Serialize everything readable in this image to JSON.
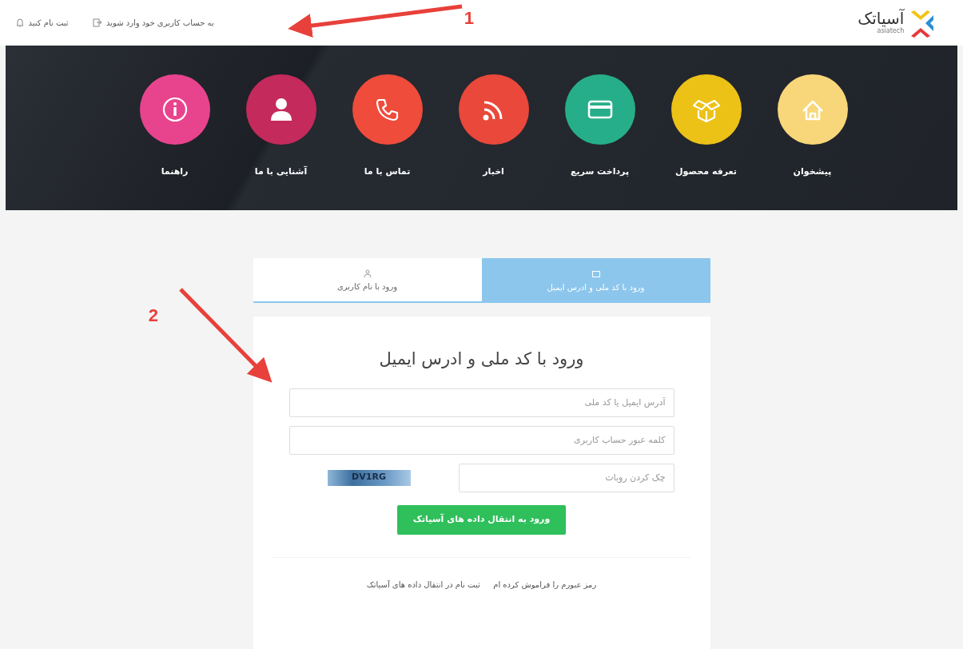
{
  "header": {
    "logo": {
      "text": "آسیاتک",
      "subtext": "asiatech"
    },
    "links": [
      {
        "label": "به حساب کاربری خود وارد شوید"
      },
      {
        "label": "ثبت نام کنید"
      }
    ]
  },
  "nav": [
    {
      "label": "پیشخوان",
      "color": "#f8d77a"
    },
    {
      "label": "تعرفه محصول",
      "color": "#ecc217"
    },
    {
      "label": "پرداخت سریع",
      "color": "#26ae8a"
    },
    {
      "label": "اخبار",
      "color": "#e9483a"
    },
    {
      "label": "تماس با ما",
      "color": "#ef4c3b"
    },
    {
      "label": "آشنایی با ما",
      "color": "#c42a5c"
    },
    {
      "label": "راهنما",
      "color": "#e8448e"
    }
  ],
  "tabs": [
    {
      "label": "ورود با کد ملی و ادرس ایمیل",
      "selected": true
    },
    {
      "label": "ورود با نام کاربری",
      "selected": false
    }
  ],
  "form": {
    "title": "ورود با کد ملی و ادرس ایمیل",
    "fields": [
      {
        "placeholder": "آدرس ایمیل یا کد ملی"
      },
      {
        "placeholder": "کلمه عبور حساب کاربری"
      }
    ],
    "captcha": {
      "placeholder": "چک کردن روبات",
      "code": "DV1RG"
    },
    "submit": "ورود به انتقال داده های آسیاتک",
    "links": [
      "رمز عبورم را فراموش کرده ام",
      "ثبت نام در انتقال داده های آسیاتک"
    ]
  },
  "annotations": [
    {
      "label": "1"
    },
    {
      "label": "2"
    }
  ]
}
